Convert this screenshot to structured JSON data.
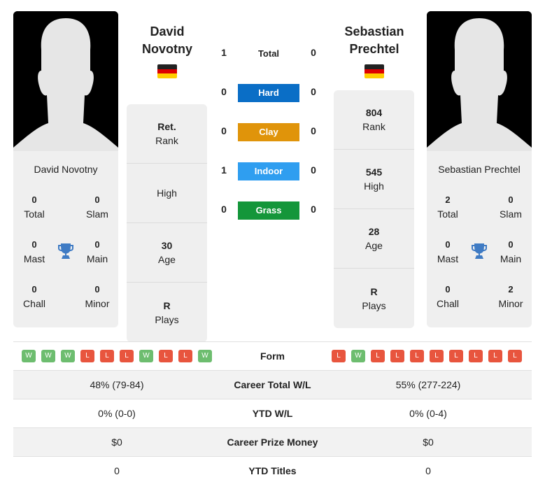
{
  "player1": {
    "name_line1": "David",
    "name_line2": "Novotny",
    "full_name": "David Novotny",
    "flag": "germany-flag",
    "titles": {
      "total": "0",
      "total_label": "Total",
      "slam": "0",
      "slam_label": "Slam",
      "mast": "0",
      "mast_label": "Mast",
      "main": "0",
      "main_label": "Main",
      "chall": "0",
      "chall_label": "Chall",
      "minor": "0",
      "minor_label": "Minor"
    },
    "stats": [
      {
        "value": "Ret.",
        "label": "Rank"
      },
      {
        "value": "",
        "label": "High"
      },
      {
        "value": "30",
        "label": "Age"
      },
      {
        "value": "R",
        "label": "Plays"
      }
    ],
    "form": [
      "W",
      "W",
      "W",
      "L",
      "L",
      "L",
      "W",
      "L",
      "L",
      "W"
    ]
  },
  "player2": {
    "name_line1": "Sebastian",
    "name_line2": "Prechtel",
    "full_name": "Sebastian Prechtel",
    "flag": "germany-flag",
    "titles": {
      "total": "2",
      "total_label": "Total",
      "slam": "0",
      "slam_label": "Slam",
      "mast": "0",
      "mast_label": "Mast",
      "main": "0",
      "main_label": "Main",
      "chall": "0",
      "chall_label": "Chall",
      "minor": "2",
      "minor_label": "Minor"
    },
    "stats": [
      {
        "value": "804",
        "label": "Rank"
      },
      {
        "value": "545",
        "label": "High"
      },
      {
        "value": "28",
        "label": "Age"
      },
      {
        "value": "R",
        "label": "Plays"
      }
    ],
    "form": [
      "L",
      "W",
      "L",
      "L",
      "L",
      "L",
      "L",
      "L",
      "L",
      "L"
    ]
  },
  "h2h": {
    "total": {
      "label": "Total",
      "p1": "1",
      "p2": "0"
    },
    "surfaces": [
      {
        "label": "Hard",
        "p1": "0",
        "p2": "0",
        "color": "#0a6ec6"
      },
      {
        "label": "Clay",
        "p1": "0",
        "p2": "0",
        "color": "#e0940a"
      },
      {
        "label": "Indoor",
        "p1": "1",
        "p2": "0",
        "color": "#2f9ef0"
      },
      {
        "label": "Grass",
        "p1": "0",
        "p2": "0",
        "color": "#14963a"
      }
    ]
  },
  "comparison": {
    "form_label": "Form",
    "rows": [
      {
        "label": "Career Total W/L",
        "p1": "48% (79-84)",
        "p2": "55% (277-224)"
      },
      {
        "label": "YTD W/L",
        "p1": "0% (0-0)",
        "p2": "0% (0-4)"
      },
      {
        "label": "Career Prize Money",
        "p1": "$0",
        "p2": "$0"
      },
      {
        "label": "YTD Titles",
        "p1": "0",
        "p2": "0"
      }
    ]
  },
  "colors": {
    "win": "#6dbd6f",
    "loss": "#e8553e",
    "trophy": "#3f7bc4",
    "card_bg": "#efefef"
  }
}
